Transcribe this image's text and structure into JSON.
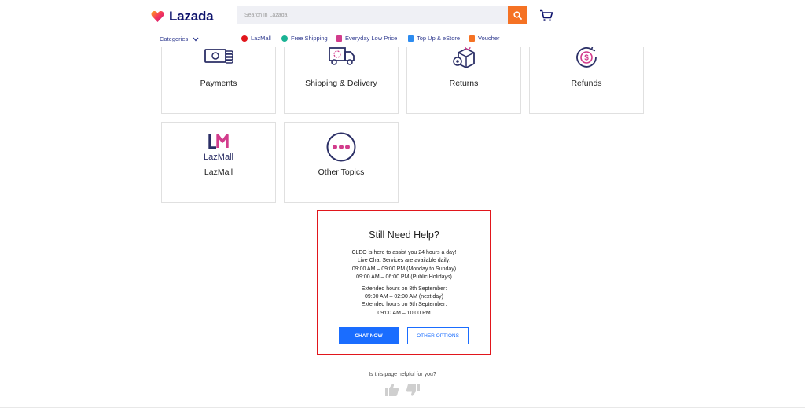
{
  "header": {
    "logo_text": "Lazada",
    "search_placeholder": "Search in Lazada"
  },
  "nav": {
    "categories_label": "Categories",
    "items": [
      {
        "label": "LazMall",
        "icon": "lazmall-badge-icon",
        "color": "#e1161c"
      },
      {
        "label": "Free Shipping",
        "icon": "free-shipping-icon",
        "color": "#1ab394"
      },
      {
        "label": "Everyday Low Price",
        "icon": "low-price-icon",
        "color": "#d23c8c"
      },
      {
        "label": "Top Up & eStore",
        "icon": "top-up-icon",
        "color": "#2d8cf0"
      },
      {
        "label": "Voucher",
        "icon": "voucher-icon",
        "color": "#f57224"
      }
    ]
  },
  "topics": [
    {
      "label": "Payments",
      "icon": "payments-icon"
    },
    {
      "label": "Shipping & Delivery",
      "icon": "shipping-truck-icon"
    },
    {
      "label": "Returns",
      "icon": "returns-box-icon"
    },
    {
      "label": "Refunds",
      "icon": "refunds-icon"
    },
    {
      "label": "LazMall",
      "icon": "lazmall-logo-icon",
      "icon_text": "LazMall"
    },
    {
      "label": "Other Topics",
      "icon": "more-dots-icon"
    }
  ],
  "help": {
    "title": "Still Need Help?",
    "lines_a": [
      "CLEO is here to assist you 24 hours a day!",
      "Live Chat Services are available daily:",
      "09:00 AM – 09:00 PM (Monday to Sunday)",
      "09:00 AM – 06:00 PM (Public Holidays)"
    ],
    "lines_b": [
      "Extended hours on 8th September:",
      "09:00 AM – 02:00 AM (next day)",
      "Extended hours on 9th September:",
      "09:00 AM – 10:00 PM"
    ],
    "chat_button": "CHAT NOW",
    "other_button": "OTHER OPTIONS",
    "highlight_color": "#e1161c"
  },
  "feedback": {
    "question": "Is this page helpful for you?"
  },
  "colors": {
    "brand_navy": "#0f146d",
    "accent_orange": "#f57224",
    "primary_blue": "#1a6dff",
    "icon_navy": "#2b2f66",
    "icon_pink": "#d23c8c"
  }
}
